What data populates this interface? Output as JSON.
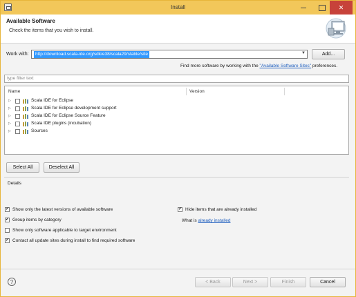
{
  "window": {
    "title": "Install",
    "close_glyph": "✕"
  },
  "header": {
    "title": "Available Software",
    "subtitle": "Check the items that you wish to install.",
    "graphic_icon": "monitor-install-icon"
  },
  "work_with": {
    "label": "Work with:",
    "value": "http://download.scala-ide.org/sdk/e38/scala29/stable/site",
    "add_label": "Add...",
    "more_prefix": "Find more software by working with the ",
    "more_link": "\"Available Software Sites\"",
    "more_suffix": " preferences."
  },
  "filter": {
    "placeholder": "type filter text"
  },
  "table": {
    "columns": [
      "Name",
      "Version"
    ],
    "rows": [
      {
        "label": "Scala IDE for Eclipse",
        "checked": false
      },
      {
        "label": "Scala IDE for Eclipse development support",
        "checked": false
      },
      {
        "label": "Scala IDE for Eclipse Source Feature",
        "checked": false
      },
      {
        "label": "Scala IDE plugins (incubation)",
        "checked": false
      },
      {
        "label": "Sources",
        "checked": false
      }
    ]
  },
  "actions": {
    "select_all": "Select All",
    "deselect_all": "Deselect All"
  },
  "details": {
    "label": "Details"
  },
  "options": {
    "latest_versions": {
      "label": "Show only the latest versions of available software",
      "checked": true
    },
    "hide_installed": {
      "label": "Hide items that are already installed",
      "checked": true
    },
    "group_by_category": {
      "label": "Group items by category",
      "checked": true
    },
    "what_is_prefix": "What is ",
    "already_installed_link": "already installed",
    "applicable_only": {
      "label": "Show only software applicable to target environment",
      "checked": false
    },
    "contact_sites": {
      "label": "Contact all update sites during install to find required software",
      "checked": true
    }
  },
  "footer": {
    "help_glyph": "?",
    "back": "< Back",
    "next": "Next >",
    "finish": "Finish",
    "cancel": "Cancel"
  },
  "colors": {
    "title_bar": "#f2c75a",
    "close_button": "#c7423a",
    "selection": "#3399ff",
    "link": "#1f5fbf"
  }
}
